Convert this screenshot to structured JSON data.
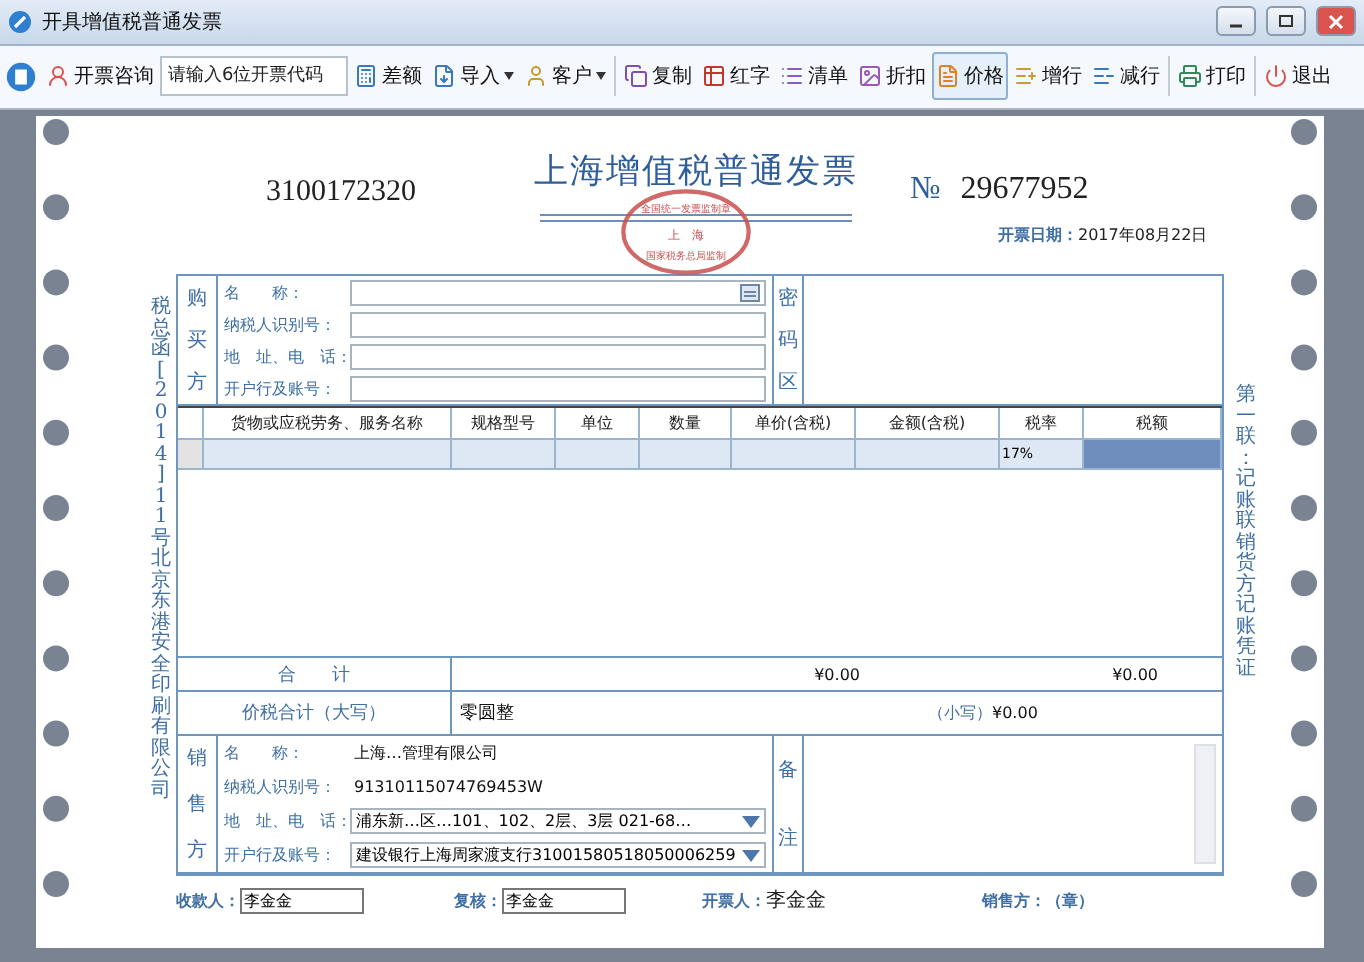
{
  "window": {
    "title": "开具增值税普通发票"
  },
  "toolbar": [
    {
      "kind": "button",
      "label": "开票咨询",
      "selected": false
    },
    {
      "kind": "field",
      "placeholder": "请输入6位开票代码"
    },
    {
      "kind": "button",
      "label": "差额",
      "selected": false
    },
    {
      "kind": "dropdown",
      "label": "导入",
      "selected": false
    },
    {
      "kind": "dropdown",
      "label": "客户",
      "selected": false
    },
    {
      "kind": "button",
      "label": "复制",
      "selected": false
    },
    {
      "kind": "button",
      "label": "红字",
      "selected": false
    },
    {
      "kind": "button",
      "label": "清单",
      "selected": false
    },
    {
      "kind": "button",
      "label": "折扣",
      "selected": false
    },
    {
      "kind": "button",
      "label": "价格",
      "selected": true
    },
    {
      "kind": "button",
      "label": "增行",
      "selected": false
    },
    {
      "kind": "button",
      "label": "减行",
      "selected": false
    },
    {
      "kind": "button",
      "label": "打印",
      "selected": false
    },
    {
      "kind": "button",
      "label": "退出",
      "selected": false
    }
  ],
  "invoice": {
    "code": "3100172320",
    "title": "上海增值税普通发票",
    "number_sign": "№",
    "number": "29677952",
    "stamp": [
      "全国统一发票监制章",
      "上　海",
      "国家税务总局监制"
    ],
    "date_label": "开票日期：",
    "date": "2017年08月22日",
    "side_left": "税总函[2014]11号北京东港安全印刷有限公司",
    "side_right": "第一联：记账联销货方记账凭证",
    "buyer": {
      "side_label": "购买方",
      "rows": [
        {
          "label": "名　　称：",
          "kind": "lookup"
        },
        {
          "label": "纳税人识别号：",
          "kind": "input"
        },
        {
          "label": "地　址、电　话：",
          "kind": "input"
        },
        {
          "label": "开户行及账号：",
          "kind": "input"
        }
      ],
      "cipher_label": "密码区"
    },
    "table": {
      "columns": [
        "货物或应税劳务、服务名称",
        "规格型号",
        "单位",
        "数量",
        "单价(含税)",
        "金额(含税)",
        "税率",
        "税额"
      ],
      "rows": [
        {
          "tax_rate": "17%",
          "selected": true
        }
      ]
    },
    "total": {
      "label": "合　　计",
      "amount": "¥0.00",
      "tax": "¥0.00"
    },
    "grand_total": {
      "label": "价税合计（大写）",
      "words": "零圆整",
      "small_label": "（小写）",
      "small": "¥0.00"
    },
    "seller": {
      "side_label": "销售方",
      "rows": [
        {
          "label": "名　　称：",
          "kind": "text",
          "value": "上海…管理有限公司"
        },
        {
          "label": "纳税人识别号：",
          "kind": "text",
          "value": "91310115074769453W"
        },
        {
          "label": "地　址、电　话：",
          "kind": "dropdown",
          "value": "浦东新…区…101、102、2层、3层 021-68…"
        },
        {
          "label": "开户行及账号：",
          "kind": "dropdown",
          "value": "建设银行上海周家渡支行31001580518050006259"
        }
      ],
      "remarks_label": "备注"
    },
    "footer": [
      {
        "kind": "field",
        "label": "收款人：",
        "value": "李金金"
      },
      {
        "kind": "field",
        "label": "复核：",
        "value": "李金金"
      },
      {
        "kind": "text",
        "label": "开票人：",
        "value": "李金金"
      },
      {
        "kind": "seal",
        "label": "销售方：（章）"
      }
    ]
  }
}
